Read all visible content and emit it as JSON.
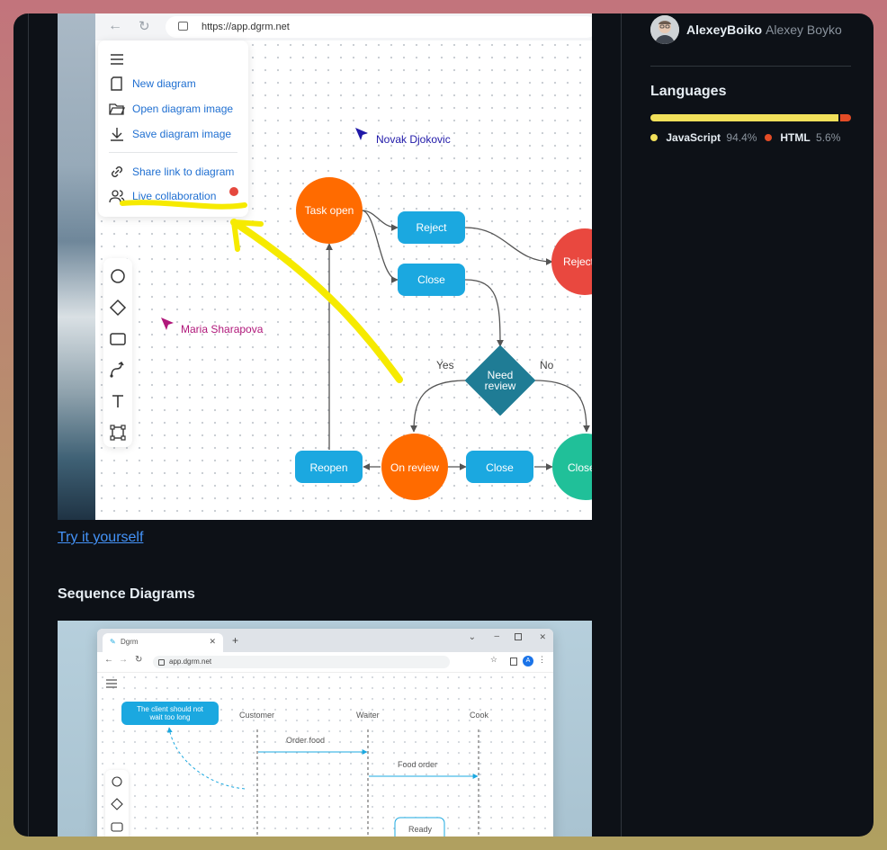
{
  "demo": {
    "url": "https://app.dgrm.net",
    "menu": {
      "items": [
        {
          "label": "New diagram",
          "icon": "new-diagram-icon"
        },
        {
          "label": "Open diagram image",
          "icon": "folder-open-icon"
        },
        {
          "label": "Save diagram image",
          "icon": "download-icon"
        },
        {
          "label": "Share link to diagram",
          "icon": "link-icon"
        },
        {
          "label": "Live collaboration",
          "icon": "users-icon"
        }
      ]
    },
    "cursors": [
      {
        "name": "Novak Djokovic",
        "color": "#1f18a8"
      },
      {
        "name": "Maria Sharapova",
        "color": "#b0177a"
      }
    ],
    "flow": {
      "task_open": "Task open",
      "reject": "Reject",
      "reject_end": "Reject",
      "close1": "Close",
      "need_review": [
        "Need",
        "review"
      ],
      "yes": "Yes",
      "no": "No",
      "reopen": "Reopen",
      "on_review": "On review",
      "close2": "Close",
      "close_end": "Close"
    },
    "colors": {
      "orange": "#ff6b00",
      "blue": "#1ba8e0",
      "red": "#e9483f",
      "teal": "#1f7c95",
      "green": "#20c099",
      "highlighter": "#f6ea00"
    }
  },
  "try_link": "Try it yourself",
  "section_heading": "Sequence Diagrams",
  "demo2": {
    "tab_title": "Dgrm",
    "url": "app.dgrm.net",
    "note": [
      "The client should not",
      "wait too long"
    ],
    "actors": [
      "Customer",
      "Waiter",
      "Cook"
    ],
    "messages": [
      "Order food",
      "Food order"
    ],
    "state": "Ready"
  },
  "profile": {
    "username": "AlexeyBoiko",
    "full_name": "Alexey Boyko"
  },
  "languages": {
    "heading": "Languages",
    "items": [
      {
        "name": "JavaScript",
        "percent": "94.4%",
        "share": 94.4,
        "color": "#f1e05a"
      },
      {
        "name": "HTML",
        "percent": "5.6%",
        "share": 5.6,
        "color": "#e34c26"
      }
    ]
  }
}
